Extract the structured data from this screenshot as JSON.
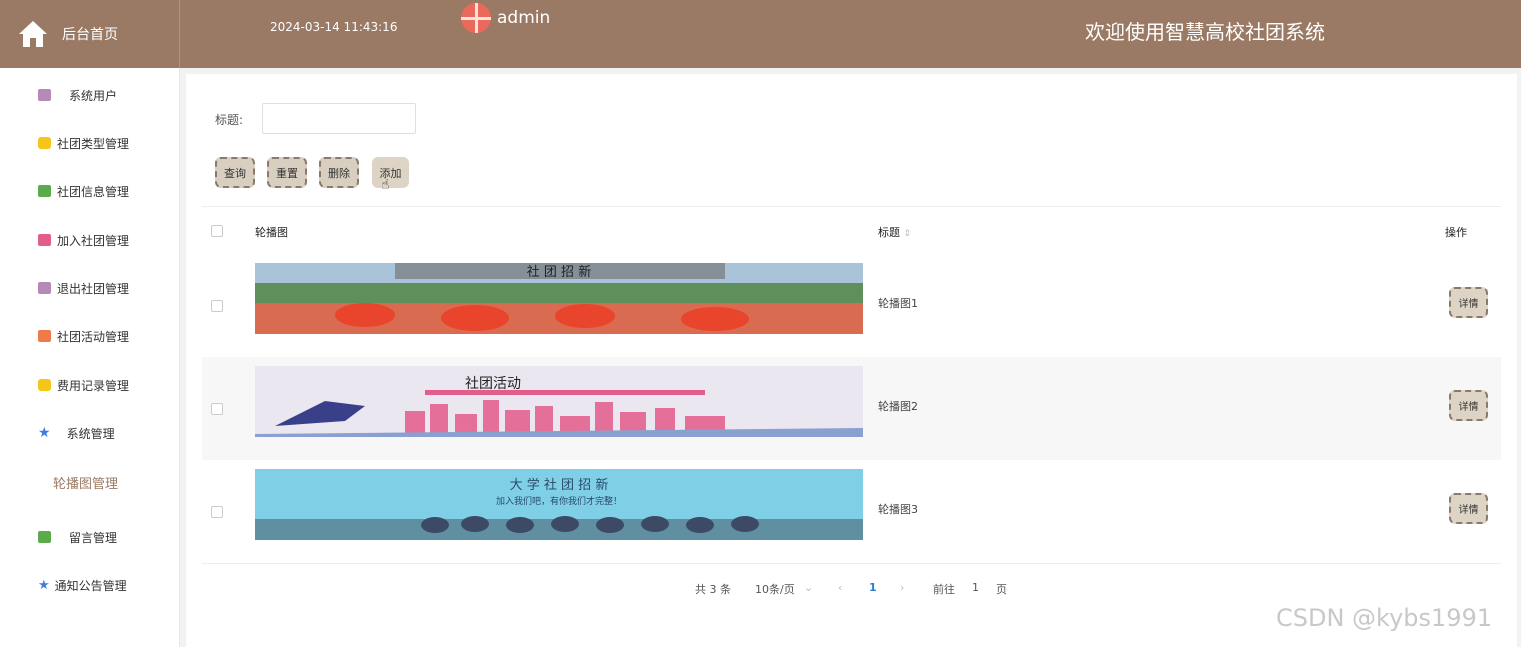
{
  "header": {
    "home_label": "后台首页",
    "datetime": "2024-03-14 11:43:16",
    "username": "admin",
    "site_title": "欢迎使用智慧高校社团系统",
    "bg_color": "#9a7a64"
  },
  "sidebar": {
    "items": [
      {
        "label": "系统用户",
        "icon": "archive-icon",
        "color": "#b58ab8"
      },
      {
        "label": "社团类型管理",
        "icon": "cube-icon",
        "color": "#f5c518"
      },
      {
        "label": "社团信息管理",
        "icon": "chat-icon",
        "color": "#5cab4a"
      },
      {
        "label": "加入社团管理",
        "icon": "clipboard-icon",
        "color": "#e35d8c"
      },
      {
        "label": "退出社团管理",
        "icon": "archive-icon",
        "color": "#b58ab8"
      },
      {
        "label": "社团活动管理",
        "icon": "grid-icon",
        "color": "#f07b4a"
      },
      {
        "label": "费用记录管理",
        "icon": "cube-icon",
        "color": "#f5c518"
      },
      {
        "label": "系统管理",
        "icon": "star-icon",
        "color": "#3e7de0"
      },
      {
        "label": "轮播图管理",
        "icon": "",
        "color": "#9a7a64"
      },
      {
        "label": "留言管理",
        "icon": "chat-icon",
        "color": "#5cab4a"
      },
      {
        "label": "通知公告管理",
        "icon": "star-icon",
        "color": "#3e7de0"
      }
    ]
  },
  "search": {
    "label": "标题:",
    "value": ""
  },
  "toolbar": {
    "query": "查询",
    "reset": "重置",
    "delete": "删除",
    "add": "添加"
  },
  "table": {
    "headers": {
      "image": "轮播图",
      "title": "标题",
      "action": "操作"
    },
    "rows": [
      {
        "title": "轮播图1",
        "banner_text": "社 团 招 新",
        "action": "详情"
      },
      {
        "title": "轮播图2",
        "banner_text": "社团活动",
        "action": "详情"
      },
      {
        "title": "轮播图3",
        "banner_text": "大 学 社 团 招 新",
        "banner_sub": "加入我们吧，有你我们才完整！",
        "action": "详情"
      }
    ]
  },
  "pagination": {
    "total": "共 3 条",
    "page_size": "10条/页",
    "current_page": "1",
    "goto_prefix": "前往",
    "goto_value": "1",
    "goto_suffix": "页"
  },
  "watermark": "CSDN @kybs1991"
}
